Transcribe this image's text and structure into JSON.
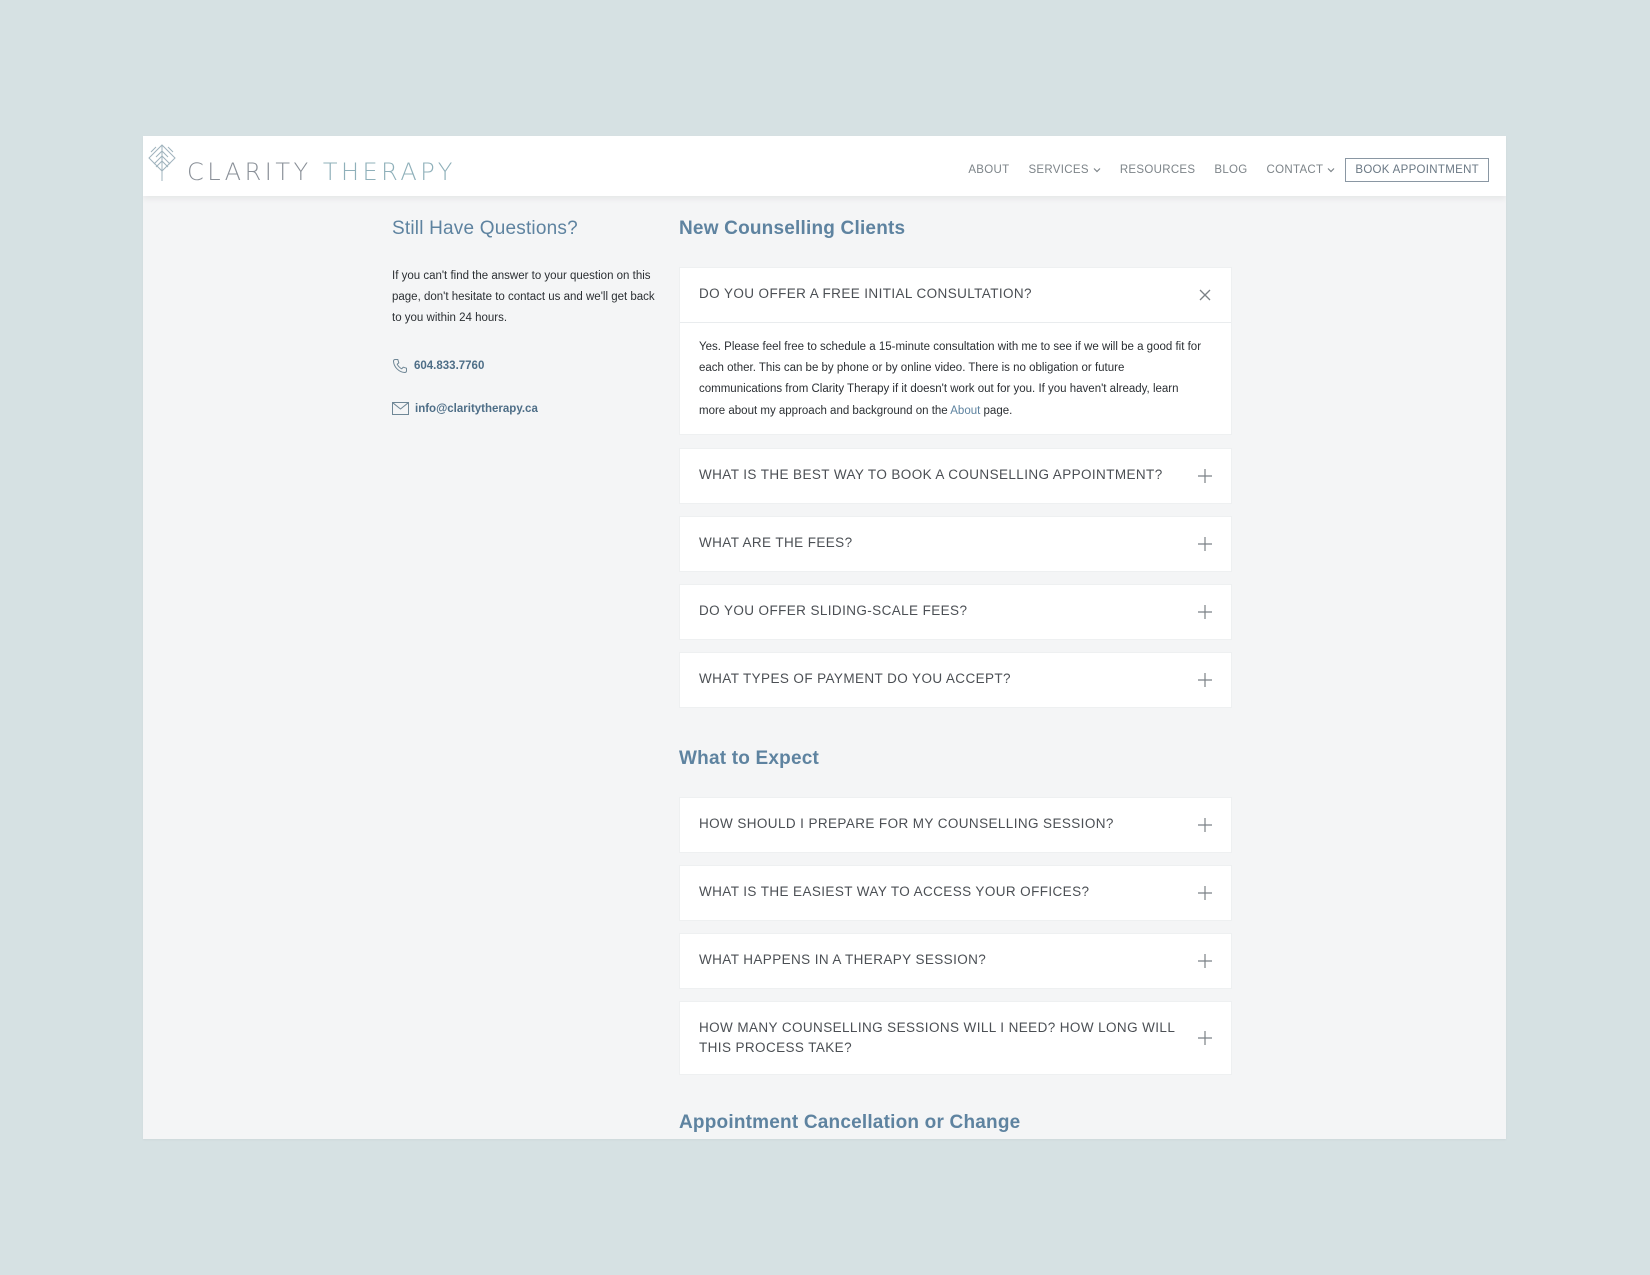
{
  "brand": {
    "word1": "CLARITY",
    "word2": "THERAPY",
    "icon": "leaf-logo-icon"
  },
  "nav": {
    "items": [
      {
        "label": "ABOUT",
        "dropdown": false
      },
      {
        "label": "SERVICES",
        "dropdown": true
      },
      {
        "label": "RESOURCES",
        "dropdown": false
      },
      {
        "label": "BLOG",
        "dropdown": false
      },
      {
        "label": "CONTACT",
        "dropdown": true
      }
    ],
    "cta": "BOOK APPOINTMENT"
  },
  "sidebar": {
    "title": "Still Have Questions?",
    "text": "If you can't find the answer to your question on this page, don't hesitate to contact us and we'll get back to you within 24 hours.",
    "phone": "604.833.7760",
    "email": "info@claritytherapy.ca"
  },
  "sections": [
    {
      "title": "New Counselling Clients",
      "items": [
        {
          "question": "DO YOU OFFER A FREE INITIAL CONSULTATION?",
          "expanded": true,
          "answer_before": "Yes. Please feel free to schedule a 15-minute consultation with me to see if we will be a good fit for each other. This can be by phone or by online video. There is no obligation or future communications from Clarity Therapy if it doesn't work out for you. If you haven't already, learn more about my approach and background on the ",
          "answer_link": "About",
          "answer_after": " page."
        },
        {
          "question": "WHAT IS THE BEST WAY TO BOOK A COUNSELLING APPOINTMENT?",
          "expanded": false
        },
        {
          "question": "WHAT ARE THE FEES?",
          "expanded": false
        },
        {
          "question": "DO YOU OFFER SLIDING-SCALE FEES?",
          "expanded": false
        },
        {
          "question": "WHAT TYPES OF PAYMENT DO YOU ACCEPT?",
          "expanded": false
        }
      ]
    },
    {
      "title": "What to Expect",
      "items": [
        {
          "question": "HOW SHOULD I PREPARE FOR MY COUNSELLING SESSION?",
          "expanded": false
        },
        {
          "question": "WHAT IS THE EASIEST WAY TO ACCESS YOUR OFFICES?",
          "expanded": false
        },
        {
          "question": "WHAT HAPPENS IN A THERAPY SESSION?",
          "expanded": false
        },
        {
          "question": "HOW MANY COUNSELLING SESSIONS WILL I NEED? HOW LONG WILL THIS PROCESS TAKE?",
          "expanded": false
        }
      ]
    },
    {
      "title": "Appointment Cancellation or Change",
      "items": []
    }
  ],
  "colors": {
    "accent": "#5e83a0",
    "background": "#d6e1e3",
    "page": "#f4f5f6"
  }
}
